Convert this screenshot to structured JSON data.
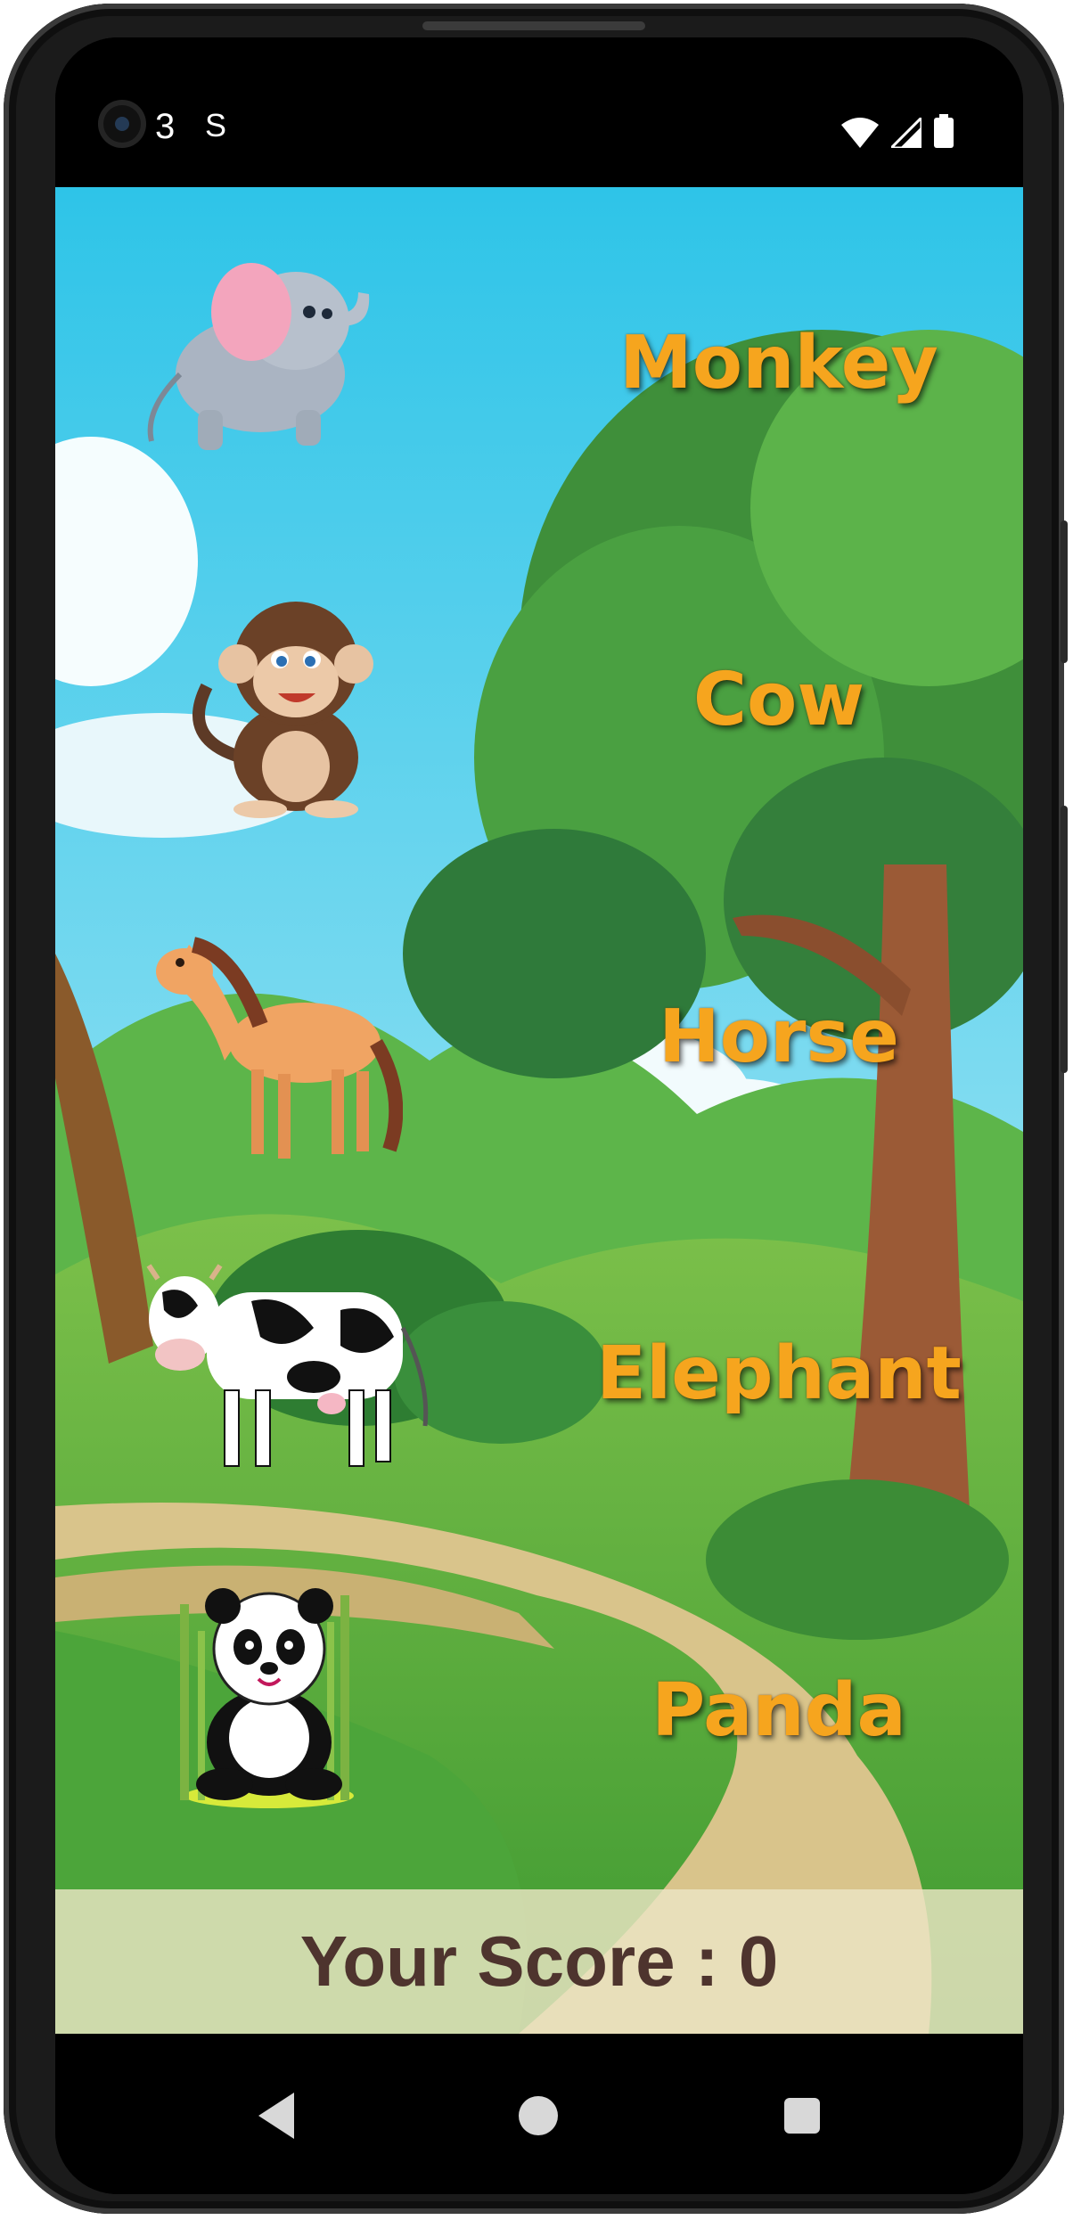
{
  "status_bar": {
    "number": "3",
    "extra_icon": "S",
    "icons": [
      "camera-icon",
      "wifi-icon",
      "signal-icon",
      "battery-icon"
    ]
  },
  "game": {
    "animals": [
      {
        "name": "elephant-image",
        "icon": "elephant"
      },
      {
        "name": "monkey-image",
        "icon": "monkey"
      },
      {
        "name": "horse-image",
        "icon": "horse"
      },
      {
        "name": "cow-image",
        "icon": "cow"
      },
      {
        "name": "panda-image",
        "icon": "panda"
      }
    ],
    "words": [
      "Monkey",
      "Cow",
      "Horse",
      "Elephant",
      "Panda"
    ],
    "word_color": "#f6a51e"
  },
  "score": {
    "label": "Your Score : 0",
    "value": 0,
    "text_color": "#4e342e"
  },
  "nav": {
    "icons": [
      "back-icon",
      "home-icon",
      "recents-icon"
    ]
  }
}
